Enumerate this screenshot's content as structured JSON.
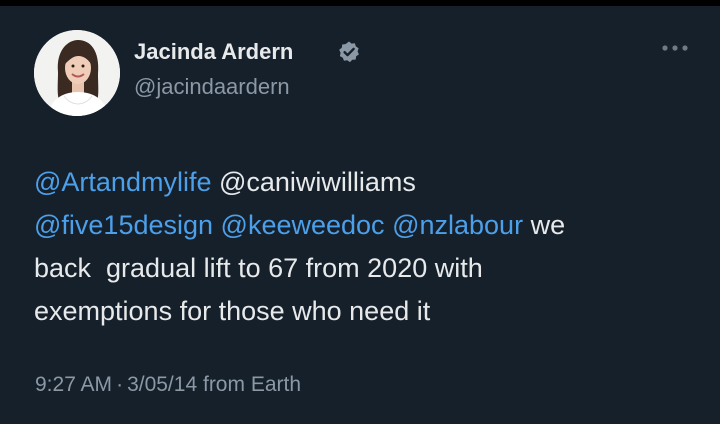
{
  "author": {
    "display_name": "Jacinda Ardern",
    "handle": "@jacindaardern",
    "avatar_icon": "profile-photo",
    "verified_icon": "verified-badge-icon",
    "verified_color": "#8b98a5"
  },
  "more_icon": "more-horizontal-icon",
  "tweet": {
    "mentions": [
      "@Artandmylife",
      "@caniwiwilliams",
      "@five15design",
      "@keeweedoc",
      "@nzlabour"
    ],
    "text_line2_tail": "we",
    "text_line3": "back  gradual lift to 67 from 2020 with",
    "text_line4": "exemptions for those who need it"
  },
  "meta": {
    "time": "9:27 AM",
    "separator": "·",
    "date": "3/05/14",
    "source": "from Earth"
  },
  "colors": {
    "background": "#15202b",
    "text": "#e7e9ea",
    "secondary": "#8b98a5",
    "mention": "#4c9fe8"
  }
}
